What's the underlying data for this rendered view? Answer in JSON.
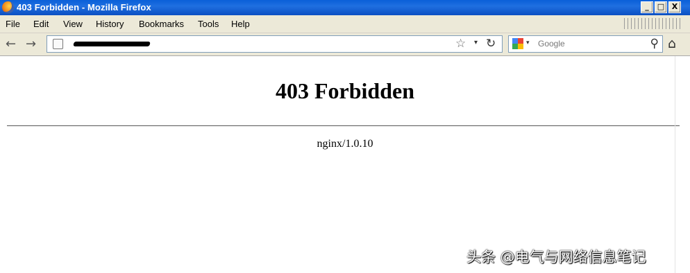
{
  "window": {
    "title": "403 Forbidden - Mozilla Firefox",
    "buttons": {
      "minimize": "_",
      "maximize": "□",
      "close": "X"
    }
  },
  "menu": [
    "File",
    "Edit",
    "View",
    "History",
    "Bookmarks",
    "Tools",
    "Help"
  ],
  "nav": {
    "back_icon": "back-arrow-icon",
    "forward_icon": "forward-arrow-icon",
    "url_redacted": true,
    "search_placeholder": "Google"
  },
  "page": {
    "heading": "403 Forbidden",
    "server": "nginx/1.0.10"
  },
  "watermark": "头条 @电气与网络信息笔记"
}
